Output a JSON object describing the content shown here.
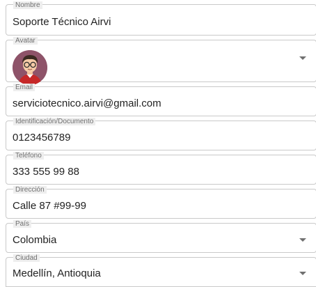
{
  "form": {
    "nombre": {
      "label": "Nombre",
      "value": "Soporte Técnico Airvi"
    },
    "avatar": {
      "label": "Avatar",
      "image": "support-agent-avatar-icon"
    },
    "email": {
      "label": "Email",
      "value": "serviciotecnico.airvi@gmail.com"
    },
    "documento": {
      "label": "Identificación/Documento",
      "value": "0123456789"
    },
    "telefono": {
      "label": "Teléfono",
      "value": "333 555 99 88"
    },
    "direccion": {
      "label": "Dirección",
      "value": "Calle 87 #99-99"
    },
    "pais": {
      "label": "País",
      "value": "Colombia"
    },
    "ciudad": {
      "label": "Ciudad",
      "value": "Medellín, Antioquia"
    }
  },
  "icons": {
    "dropdown": "caret-down-icon"
  },
  "colors": {
    "border": "#c9c9c9",
    "label_bg": "#eeeeee",
    "avatar_bg": "#8e5369",
    "shirt": "#c62828"
  }
}
